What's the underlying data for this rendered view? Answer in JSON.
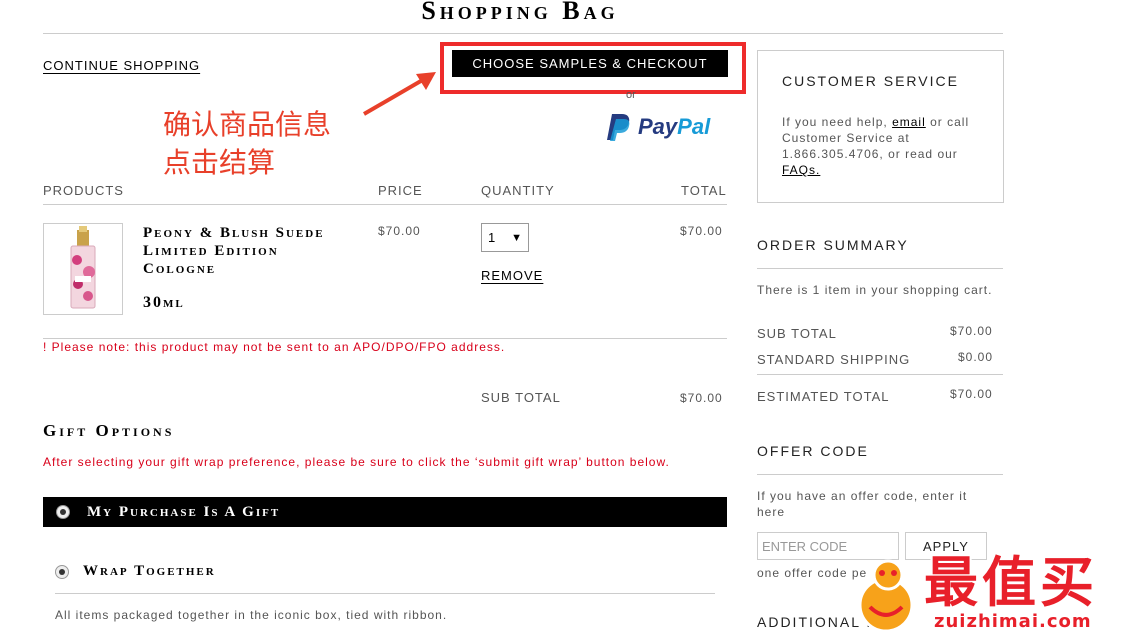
{
  "page_title": "Shopping Bag",
  "continue_shopping": "CONTINUE SHOPPING",
  "checkout": {
    "button_label": "CHOOSE SAMPLES & CHECKOUT",
    "or": "or",
    "paypal_prefix": "Pay",
    "paypal_suffix": "Pal"
  },
  "annotation": {
    "line1": "确认商品信息",
    "line2": "点击结算",
    "color": "#e8402a"
  },
  "table": {
    "headers": {
      "products": "PRODUCTS",
      "price": "PRICE",
      "quantity": "QUANTITY",
      "total": "TOTAL"
    },
    "item": {
      "name": "Peony & Blush Suede Limited Edition Cologne",
      "size": "30ml",
      "price": "$70.00",
      "quantity": "1",
      "total": "$70.00",
      "remove": "REMOVE"
    },
    "apo_note": "! Please note: this product may not be sent to an APO/DPO/FPO address.",
    "subtotal_label": "SUB TOTAL",
    "subtotal_value": "$70.00"
  },
  "gift": {
    "title": "Gift Options",
    "note": "After selecting your gift wrap preference, please be sure to click the ‘submit gift wrap’ button below.",
    "purchase_gift": "My Purchase Is A Gift",
    "wrap_together": "Wrap Together",
    "wrap_description": "All items packaged together in the iconic box, tied with ribbon."
  },
  "customer_service": {
    "title": "CUSTOMER SERVICE",
    "text_before_email": "If you need help, ",
    "email_link": "email",
    "text_after_email": " or call Customer Service at 1.866.305.4706, or read our ",
    "faq_link": "FAQs."
  },
  "order_summary": {
    "title": "ORDER SUMMARY",
    "item_count_text": "There is 1 item in your shopping cart.",
    "sub_total_label": "SUB TOTAL",
    "sub_total_value": "$70.00",
    "shipping_label": "STANDARD SHIPPING",
    "shipping_value": "$0.00",
    "estimated_label": "ESTIMATED TOTAL",
    "estimated_value": "$70.00"
  },
  "offer_code": {
    "title": "OFFER CODE",
    "description": "If you have an offer code, enter it here",
    "placeholder": "ENTER CODE",
    "apply": "APPLY",
    "limit_text": "one offer code pe"
  },
  "additional": "ADDITIONAL IN",
  "watermark": {
    "chars": "值买",
    "first_char": "最",
    "url": "zuizhimai.com"
  },
  "colors": {
    "alert_red": "#d8001a",
    "highlight_box": "#ee2b2b",
    "paypal_dark": "#253b80",
    "paypal_light": "#179bd7"
  }
}
